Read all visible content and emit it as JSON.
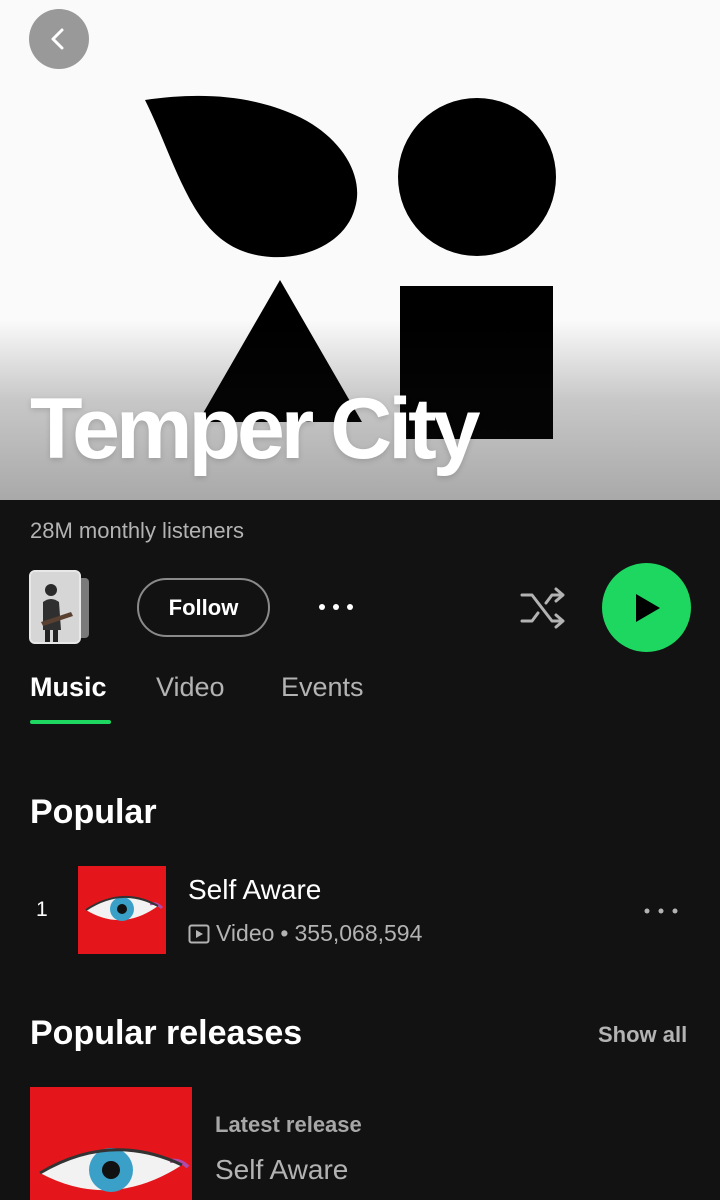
{
  "artist": {
    "name": "Temper City",
    "listeners": "28M monthly listeners"
  },
  "actions": {
    "follow_label": "Follow"
  },
  "tabs": [
    {
      "label": "Music",
      "active": true
    },
    {
      "label": "Video",
      "active": false
    },
    {
      "label": "Events",
      "active": false
    }
  ],
  "popular": {
    "title": "Popular",
    "tracks": [
      {
        "rank": "1",
        "title": "Self Aware",
        "type": "Video",
        "plays": "355,068,594"
      }
    ]
  },
  "releases": {
    "title": "Popular releases",
    "show_all_label": "Show all",
    "items": [
      {
        "label": "Latest release",
        "title": "Self Aware"
      }
    ]
  },
  "colors": {
    "accent": "#1ed760",
    "background": "#121212",
    "cover_red": "#e5161b"
  },
  "icons": [
    "back-chevron-icon",
    "more-dots-icon",
    "shuffle-icon",
    "play-icon",
    "video-icon"
  ]
}
